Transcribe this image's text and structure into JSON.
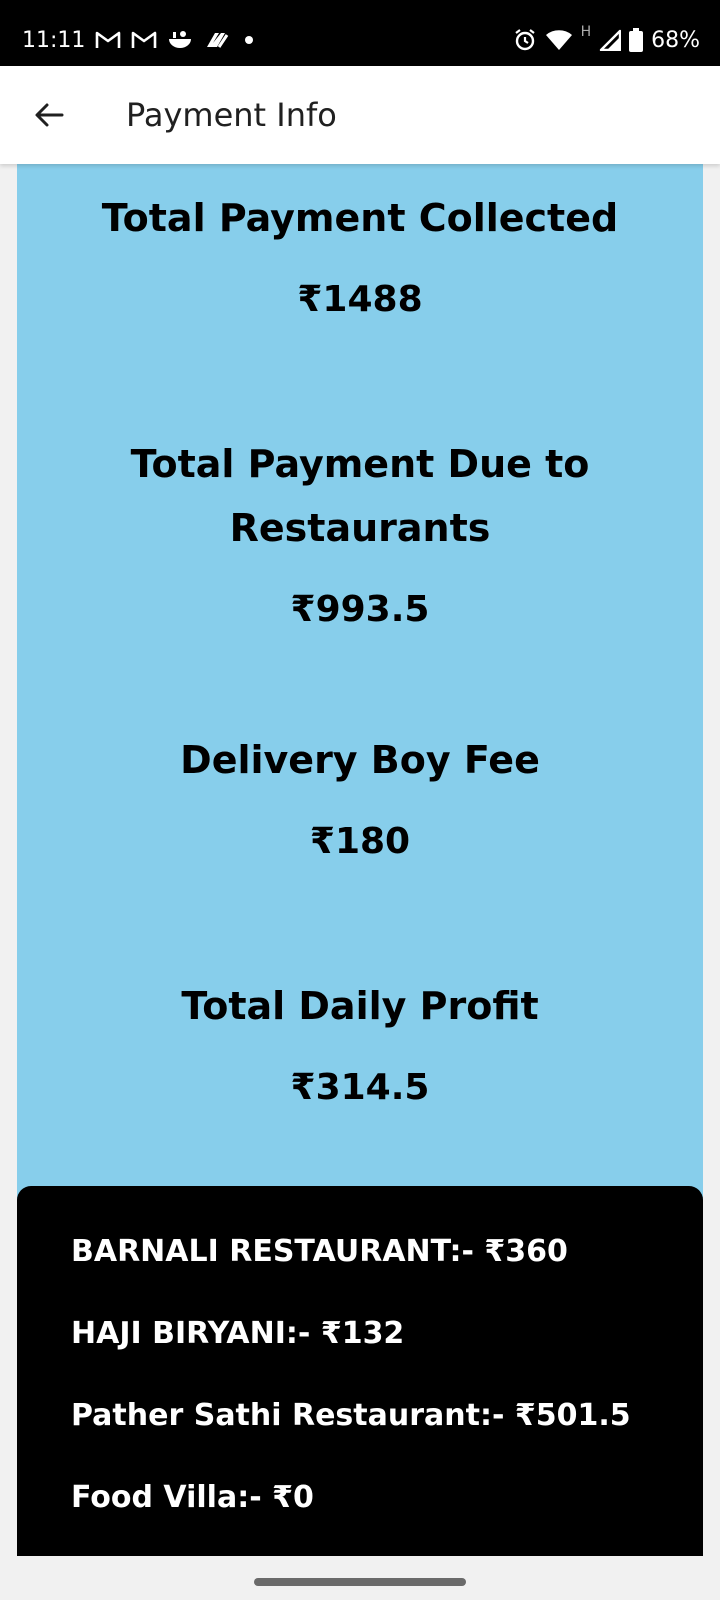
{
  "status_bar": {
    "time": "11:11",
    "left_icons": [
      "gmail-icon",
      "gmail-icon",
      "delivery-app-icon",
      "phonepe-app-icon",
      "dot-icon"
    ],
    "right_icons": [
      "alarm-icon",
      "wifi-icon",
      "network-h-icon",
      "signal-icon",
      "battery-icon"
    ],
    "network_type": "H",
    "battery": "68%"
  },
  "header": {
    "back_icon": "arrow-left-icon",
    "title": "Payment Info"
  },
  "summary": [
    {
      "label": "Total Payment Collected",
      "value": "₹1488"
    },
    {
      "label": "Total Payment Due to Restaurants",
      "value": "₹993.5"
    },
    {
      "label": "Delivery Boy Fee",
      "value": "₹180"
    },
    {
      "label": "Total Daily Profit",
      "value": "₹314.5"
    }
  ],
  "restaurants": [
    "BARNALI RESTAURANT:- ₹360",
    "HAJI BIRYANI:- ₹132",
    "Pather Sathi Restaurant:- ₹501.5",
    "Food Villa:- ₹0"
  ],
  "colors": {
    "summary_background": "#87ceeb",
    "restaurant_panel_background": "#000000",
    "status_bar_background": "#000000",
    "app_bar_background": "#ffffff"
  }
}
